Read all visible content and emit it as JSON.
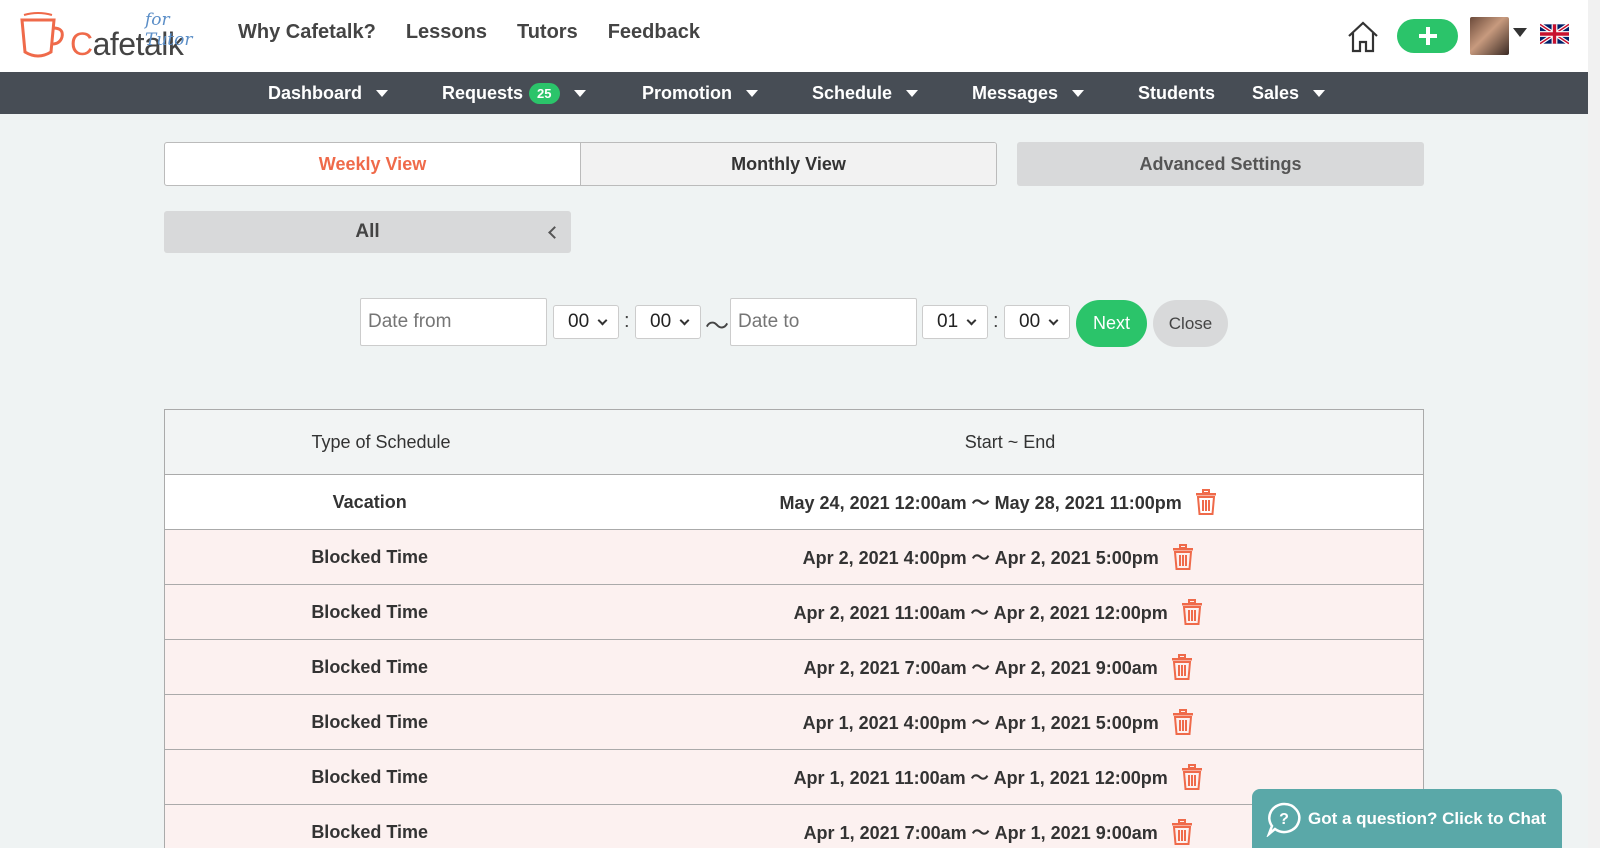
{
  "header": {
    "logo_text_c": "C",
    "logo_text_rest": "afetalk",
    "logo_sub": "for Tutor",
    "nav": [
      "Why Cafetalk?",
      "Lessons",
      "Tutors",
      "Feedback"
    ]
  },
  "subnav": {
    "dashboard": "Dashboard",
    "requests": "Requests",
    "requests_badge": "25",
    "promotion": "Promotion",
    "schedule": "Schedule",
    "messages": "Messages",
    "students": "Students",
    "sales": "Sales"
  },
  "tabs": {
    "weekly": "Weekly View",
    "monthly": "Monthly View",
    "advanced": "Advanced Settings"
  },
  "filter": {
    "all": "All"
  },
  "date_row": {
    "date_from_placeholder": "Date from",
    "from_hour": "00",
    "from_min": "00",
    "date_to_placeholder": "Date to",
    "to_hour": "01",
    "to_min": "00",
    "colon": ":",
    "tilde": "〜",
    "next": "Next",
    "close": "Close"
  },
  "table": {
    "headers": [
      "Type of Schedule",
      "Start ~ End"
    ],
    "rows": [
      {
        "type": "Vacation",
        "range": "May 24, 2021 12:00am 〜 May 28, 2021 11:00pm"
      },
      {
        "type": "Blocked Time",
        "range": "Apr 2, 2021 4:00pm 〜 Apr 2, 2021 5:00pm"
      },
      {
        "type": "Blocked Time",
        "range": "Apr 2, 2021 11:00am 〜 Apr 2, 2021 12:00pm"
      },
      {
        "type": "Blocked Time",
        "range": "Apr 2, 2021 7:00am 〜 Apr 2, 2021 9:00am"
      },
      {
        "type": "Blocked Time",
        "range": "Apr 1, 2021 4:00pm 〜 Apr 1, 2021 5:00pm"
      },
      {
        "type": "Blocked Time",
        "range": "Apr 1, 2021 11:00am 〜 Apr 1, 2021 12:00pm"
      },
      {
        "type": "Blocked Time",
        "range": "Apr 1, 2021 7:00am 〜 Apr 1, 2021 9:00am"
      }
    ]
  },
  "chat": {
    "label": "Got a question? Click to Chat"
  },
  "colors": {
    "accent": "#ef6a4a",
    "green": "#2bc46a",
    "nav_dark": "#474d55",
    "chat": "#5aa8a8"
  },
  "icons": [
    "cup-logo-icon",
    "home-icon",
    "plus-icon",
    "avatar",
    "uk-flag-icon",
    "trash-icon",
    "chat-question-icon"
  ]
}
